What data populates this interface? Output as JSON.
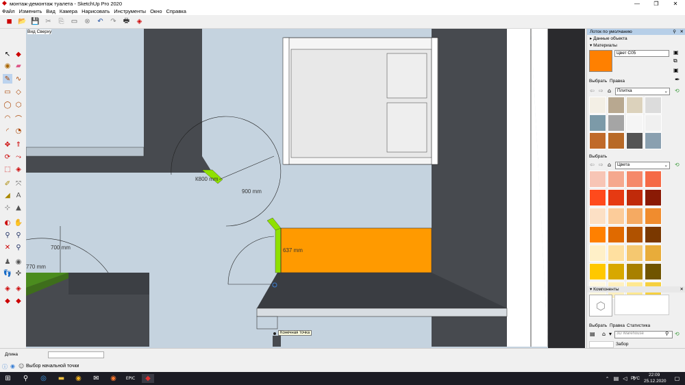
{
  "window": {
    "title": "монтаж-демонтаж туалета - SketchUp Pro 2020"
  },
  "menu": [
    "Файл",
    "Изменить",
    "Вид",
    "Камера",
    "Нарисовать",
    "Инструменты",
    "Окно",
    "Справка"
  ],
  "viewport": {
    "view_label": "Вид Сверху",
    "dims": {
      "k800": "К800 mm",
      "d900": "900 mm",
      "d700": "700 mm",
      "d770": "770 mm",
      "d637": "637 mm"
    },
    "tooltip": "Конечная точка"
  },
  "tray": {
    "title": "Лоток по умолчанию",
    "entity_info": "Данные объекта",
    "materials": "Материалы",
    "material_name": "Цвет C05",
    "material_color": "#ff8000",
    "tab_select": "Выбрать",
    "tab_edit": "Правка",
    "library1": "Плитка",
    "library2": "Цвета",
    "select_label2": "Выбрать",
    "components": "Компоненты",
    "comp_tabs": [
      "Выбрать",
      "Правка",
      "Статистика"
    ],
    "search_placeholder": "3D Warehouse",
    "comp_item": "Забор"
  },
  "status": {
    "measurement_label": "Длина",
    "measurement_value": "",
    "hint": "Выбор начальной точки"
  },
  "taskbar": {
    "lang": "РУС",
    "time": "22:09",
    "date": "25.12.2020"
  },
  "colors": {
    "swatches_rows": [
      [
        "#f7c5b5",
        "#f5a88e",
        "#f5896a",
        "#f56a46"
      ],
      [
        "#ff4a1c",
        "#e63a12",
        "#c02a0a",
        "#8a1a05"
      ],
      [
        "#fce0c5",
        "#fccc9a",
        "#f5aa62",
        "#f08c2e"
      ],
      [
        "#ff8000",
        "#e06a00",
        "#b05200",
        "#7a3800"
      ],
      [
        "#fff0c8",
        "#ffe0a0",
        "#f5c870",
        "#e8ac3a"
      ],
      [
        "#ffc800",
        "#d8a800",
        "#a88000",
        "#705400"
      ],
      [
        "#fff8e0",
        "#fff0c0",
        "#ffe890",
        "#f5d040"
      ]
    ]
  }
}
